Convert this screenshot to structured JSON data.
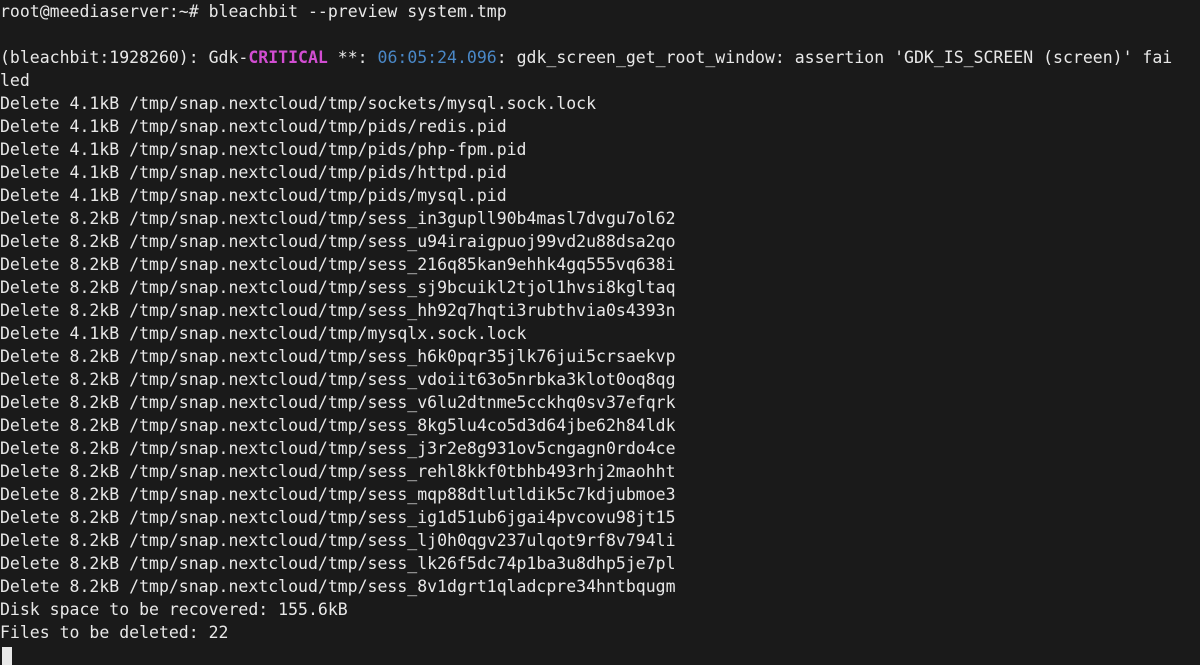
{
  "prompt": "root@meediaserver:~# ",
  "command": "bleachbit --preview system.tmp",
  "warning": {
    "prefix": "(bleachbit:1928260): Gdk-",
    "critical": "CRITICAL",
    "mid": " **: ",
    "timestamp": "06:05:24.096",
    "message": ": gdk_screen_get_root_window: assertion 'GDK_IS_SCREEN (screen)' fai",
    "wrap": "led"
  },
  "deletes": [
    {
      "size": "4.1kB",
      "path": "/tmp/snap.nextcloud/tmp/sockets/mysql.sock.lock"
    },
    {
      "size": "4.1kB",
      "path": "/tmp/snap.nextcloud/tmp/pids/redis.pid"
    },
    {
      "size": "4.1kB",
      "path": "/tmp/snap.nextcloud/tmp/pids/php-fpm.pid"
    },
    {
      "size": "4.1kB",
      "path": "/tmp/snap.nextcloud/tmp/pids/httpd.pid"
    },
    {
      "size": "4.1kB",
      "path": "/tmp/snap.nextcloud/tmp/pids/mysql.pid"
    },
    {
      "size": "8.2kB",
      "path": "/tmp/snap.nextcloud/tmp/sess_in3gupll90b4masl7dvgu7ol62"
    },
    {
      "size": "8.2kB",
      "path": "/tmp/snap.nextcloud/tmp/sess_u94iraigpuoj99vd2u88dsa2qo"
    },
    {
      "size": "8.2kB",
      "path": "/tmp/snap.nextcloud/tmp/sess_216q85kan9ehhk4gq555vq638i"
    },
    {
      "size": "8.2kB",
      "path": "/tmp/snap.nextcloud/tmp/sess_sj9bcuikl2tjol1hvsi8kgltaq"
    },
    {
      "size": "8.2kB",
      "path": "/tmp/snap.nextcloud/tmp/sess_hh92q7hqti3rubthvia0s4393n"
    },
    {
      "size": "4.1kB",
      "path": "/tmp/snap.nextcloud/tmp/mysqlx.sock.lock"
    },
    {
      "size": "8.2kB",
      "path": "/tmp/snap.nextcloud/tmp/sess_h6k0pqr35jlk76jui5crsaekvp"
    },
    {
      "size": "8.2kB",
      "path": "/tmp/snap.nextcloud/tmp/sess_vdoiit63o5nrbka3klot0oq8qg"
    },
    {
      "size": "8.2kB",
      "path": "/tmp/snap.nextcloud/tmp/sess_v6lu2dtnme5cckhq0sv37efqrk"
    },
    {
      "size": "8.2kB",
      "path": "/tmp/snap.nextcloud/tmp/sess_8kg5lu4co5d3d64jbe62h84ldk"
    },
    {
      "size": "8.2kB",
      "path": "/tmp/snap.nextcloud/tmp/sess_j3r2e8g931ov5cngagn0rdo4ce"
    },
    {
      "size": "8.2kB",
      "path": "/tmp/snap.nextcloud/tmp/sess_rehl8kkf0tbhb493rhj2maohht"
    },
    {
      "size": "8.2kB",
      "path": "/tmp/snap.nextcloud/tmp/sess_mqp88dtlutldik5c7kdjubmoe3"
    },
    {
      "size": "8.2kB",
      "path": "/tmp/snap.nextcloud/tmp/sess_ig1d51ub6jgai4pvcovu98jt15"
    },
    {
      "size": "8.2kB",
      "path": "/tmp/snap.nextcloud/tmp/sess_lj0h0qgv237ulqot9rf8v794li"
    },
    {
      "size": "8.2kB",
      "path": "/tmp/snap.nextcloud/tmp/sess_lk26f5dc74p1ba3u8dhp5je7pl"
    },
    {
      "size": "8.2kB",
      "path": "/tmp/snap.nextcloud/tmp/sess_8v1dgrt1qladcpre34hntbqugm"
    }
  ],
  "summary": {
    "disk_label": "Disk space to be recovered: ",
    "disk_value": "155.6kB",
    "files_label": "Files to be deleted: ",
    "files_value": "22"
  }
}
